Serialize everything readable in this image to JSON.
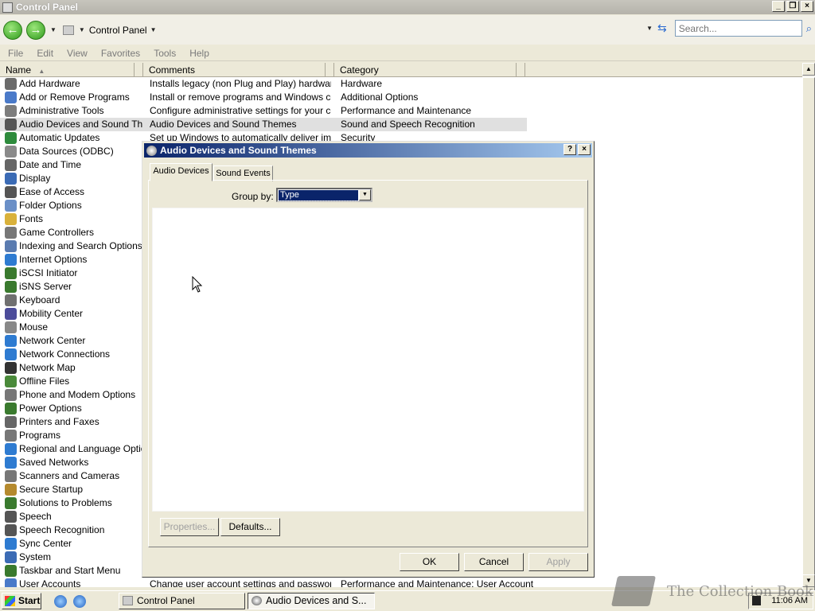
{
  "window": {
    "title": "Control Panel"
  },
  "nav": {
    "address": "Control Panel",
    "search_placeholder": "Search..."
  },
  "menu": [
    "File",
    "Edit",
    "View",
    "Favorites",
    "Tools",
    "Help"
  ],
  "columns": {
    "name": "Name",
    "comments": "Comments",
    "category": "Category"
  },
  "items": [
    {
      "name": "Add Hardware",
      "comment": "Installs legacy (non Plug and Play) hardware.",
      "category": "Hardware",
      "icon": "hardware-icon",
      "color": "#6b6b6b"
    },
    {
      "name": "Add or Remove Programs",
      "comment": "Install or remove programs and Windows com...",
      "category": "Additional Options",
      "icon": "programs-icon",
      "color": "#4a7ac9"
    },
    {
      "name": "Administrative Tools",
      "comment": "Configure administrative settings for your comp...",
      "category": "Performance and Maintenance",
      "icon": "admin-tools-icon",
      "color": "#7d7d7d"
    },
    {
      "name": "Audio Devices and Sound The...",
      "comment": "Audio Devices and Sound Themes",
      "category": "Sound and Speech Recognition",
      "icon": "audio-icon",
      "color": "#555555",
      "selected": true
    },
    {
      "name": "Automatic Updates",
      "comment": "Set up Windows to automatically deliver import...",
      "category": "Security",
      "icon": "updates-icon",
      "color": "#2e8b3c"
    },
    {
      "name": "Data Sources (ODBC)",
      "comment": "",
      "category": "",
      "icon": "odbc-icon",
      "color": "#8a8a8a"
    },
    {
      "name": "Date and Time",
      "comment": "",
      "category": "",
      "icon": "clock-icon",
      "color": "#666666"
    },
    {
      "name": "Display",
      "comment": "",
      "category": "",
      "icon": "display-icon",
      "color": "#3b6bb5"
    },
    {
      "name": "Ease of Access",
      "comment": "",
      "category": "",
      "icon": "accessibility-icon",
      "color": "#555555"
    },
    {
      "name": "Folder Options",
      "comment": "",
      "category": "",
      "icon": "folder-options-icon",
      "color": "#6a8fc7"
    },
    {
      "name": "Fonts",
      "comment": "",
      "category": "",
      "icon": "fonts-icon",
      "color": "#d9b13b"
    },
    {
      "name": "Game Controllers",
      "comment": "",
      "category": "",
      "icon": "gamepad-icon",
      "color": "#777777"
    },
    {
      "name": "Indexing and Search Options",
      "comment": "",
      "category": "",
      "icon": "indexing-icon",
      "color": "#5a7bb0"
    },
    {
      "name": "Internet Options",
      "comment": "",
      "category": "",
      "icon": "globe-icon",
      "color": "#2e7bd1"
    },
    {
      "name": "iSCSI Initiator",
      "comment": "",
      "category": "",
      "icon": "iscsi-icon",
      "color": "#3a7a2e"
    },
    {
      "name": "iSNS Server",
      "comment": "",
      "category": "",
      "icon": "isns-icon",
      "color": "#3a7a2e"
    },
    {
      "name": "Keyboard",
      "comment": "",
      "category": "",
      "icon": "keyboard-icon",
      "color": "#707070"
    },
    {
      "name": "Mobility Center",
      "comment": "",
      "category": "",
      "icon": "mobility-icon",
      "color": "#4c4c9a"
    },
    {
      "name": "Mouse",
      "comment": "",
      "category": "",
      "icon": "mouse-icon",
      "color": "#888888"
    },
    {
      "name": "Network Center",
      "comment": "",
      "category": "",
      "icon": "network-center-icon",
      "color": "#2e7bd1"
    },
    {
      "name": "Network Connections",
      "comment": "",
      "category": "",
      "icon": "network-connections-icon",
      "color": "#2e7bd1"
    },
    {
      "name": "Network Map",
      "comment": "",
      "category": "",
      "icon": "network-map-icon",
      "color": "#333333"
    },
    {
      "name": "Offline Files",
      "comment": "",
      "category": "",
      "icon": "offline-files-icon",
      "color": "#4a8a3a"
    },
    {
      "name": "Phone and Modem Options",
      "comment": "",
      "category": "",
      "icon": "phone-icon",
      "color": "#777777"
    },
    {
      "name": "Power Options",
      "comment": "",
      "category": "",
      "icon": "power-icon",
      "color": "#3a7a2e"
    },
    {
      "name": "Printers and Faxes",
      "comment": "",
      "category": "",
      "icon": "printer-icon",
      "color": "#666666"
    },
    {
      "name": "Programs",
      "comment": "",
      "category": "",
      "icon": "programs-folder-icon",
      "color": "#777777"
    },
    {
      "name": "Regional and Language Options",
      "comment": "",
      "category": "",
      "icon": "regional-icon",
      "color": "#2e7bd1"
    },
    {
      "name": "Saved Networks",
      "comment": "",
      "category": "",
      "icon": "saved-networks-icon",
      "color": "#2e7bd1"
    },
    {
      "name": "Scanners and Cameras",
      "comment": "",
      "category": "",
      "icon": "scanner-icon",
      "color": "#777777"
    },
    {
      "name": "Secure Startup",
      "comment": "",
      "category": "",
      "icon": "secure-startup-icon",
      "color": "#b58a2e"
    },
    {
      "name": "Solutions to Problems",
      "comment": "",
      "category": "",
      "icon": "solutions-icon",
      "color": "#3a7a2e"
    },
    {
      "name": "Speech",
      "comment": "",
      "category": "",
      "icon": "speech-icon",
      "color": "#555555"
    },
    {
      "name": "Speech Recognition",
      "comment": "",
      "category": "",
      "icon": "speech-recognition-icon",
      "color": "#555555"
    },
    {
      "name": "Sync Center",
      "comment": "",
      "category": "",
      "icon": "sync-icon",
      "color": "#2e7bd1"
    },
    {
      "name": "System",
      "comment": "",
      "category": "",
      "icon": "system-icon",
      "color": "#3b6bb5"
    },
    {
      "name": "Taskbar and Start Menu",
      "comment": "",
      "category": "",
      "icon": "taskbar-icon",
      "color": "#3a7a2e"
    },
    {
      "name": "User Accounts",
      "comment": "Change user account settings and passwords.",
      "category": "Performance and Maintenance; User Account",
      "icon": "user-accounts-icon",
      "color": "#4a7ac9"
    }
  ],
  "dialog": {
    "title": "Audio Devices and Sound Themes",
    "help": "?",
    "close": "×",
    "tabs": [
      "Audio Devices",
      "Sound Events"
    ],
    "group_by_label": "Group by:",
    "group_by_value": "Type",
    "buttons": {
      "properties": "Properties...",
      "defaults": "Defaults...",
      "ok": "OK",
      "cancel": "Cancel",
      "apply": "Apply"
    }
  },
  "taskbar": {
    "start": "Start",
    "tasks": [
      "Control Panel",
      "Audio Devices and S..."
    ],
    "clock": "11:06 AM"
  },
  "watermark": "The Collection Book"
}
